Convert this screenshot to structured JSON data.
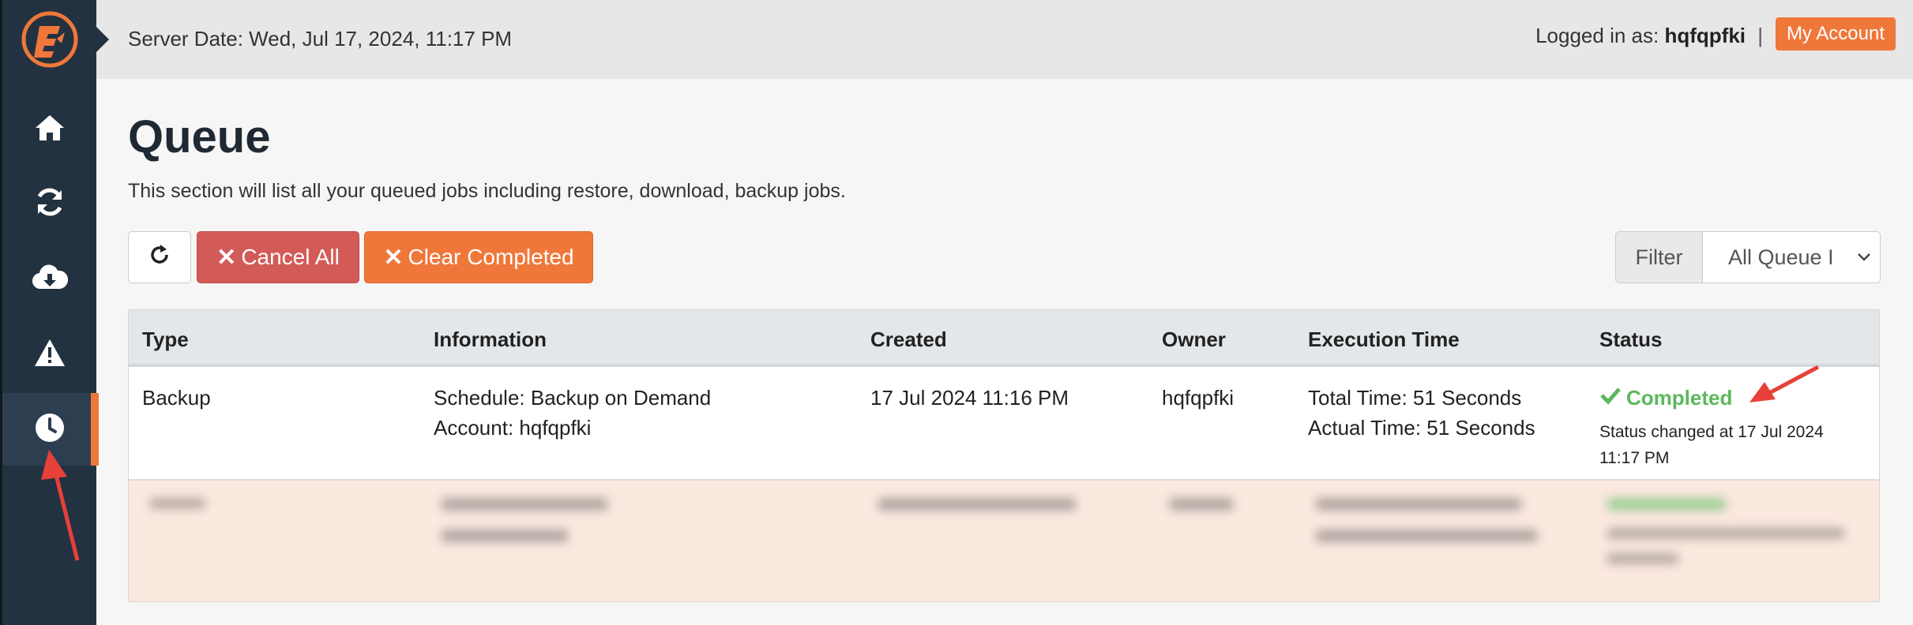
{
  "header": {
    "server_date": "Server Date: Wed, Jul 17, 2024, 11:17 PM",
    "logged_in_prefix": "Logged in as:",
    "username": "hqfqpfki",
    "separator": "|",
    "my_account_label": "My Account"
  },
  "sidebar": {
    "logo_icon": "brand-logo-icon",
    "items": [
      {
        "name": "home",
        "icon": "home-icon"
      },
      {
        "name": "sync",
        "icon": "refresh-icon"
      },
      {
        "name": "download",
        "icon": "cloud-download-icon"
      },
      {
        "name": "alerts",
        "icon": "warning-icon"
      },
      {
        "name": "queue",
        "icon": "clock-icon",
        "active": true
      }
    ]
  },
  "page": {
    "title": "Queue",
    "description": "This section will list all your queued jobs including restore, download, backup jobs."
  },
  "toolbar": {
    "refresh_icon": "refresh-icon",
    "cancel_all_label": "Cancel All",
    "clear_completed_label": "Clear Completed",
    "filter_label": "Filter",
    "filter_value": "All Queue I"
  },
  "table": {
    "columns": [
      "Type",
      "Information",
      "Created",
      "Owner",
      "Execution Time",
      "Status"
    ],
    "rows": [
      {
        "type": "Backup",
        "info_line1": "Schedule: Backup on Demand",
        "info_line2": "Account: hqfqpfki",
        "created": "17 Jul 2024 11:16 PM",
        "owner": "hqfqpfki",
        "exec_line1": "Total Time: 51 Seconds",
        "exec_line2": "Actual Time: 51 Seconds",
        "status": "Completed",
        "status_detail": "Status changed at 17 Jul 2024 11:17 PM"
      }
    ]
  },
  "colors": {
    "sidebar_bg": "#233240",
    "accent_orange": "#f0773a",
    "danger_red": "#d35b57",
    "success_green": "#5cb85c",
    "annotation_red": "#e8403a"
  }
}
